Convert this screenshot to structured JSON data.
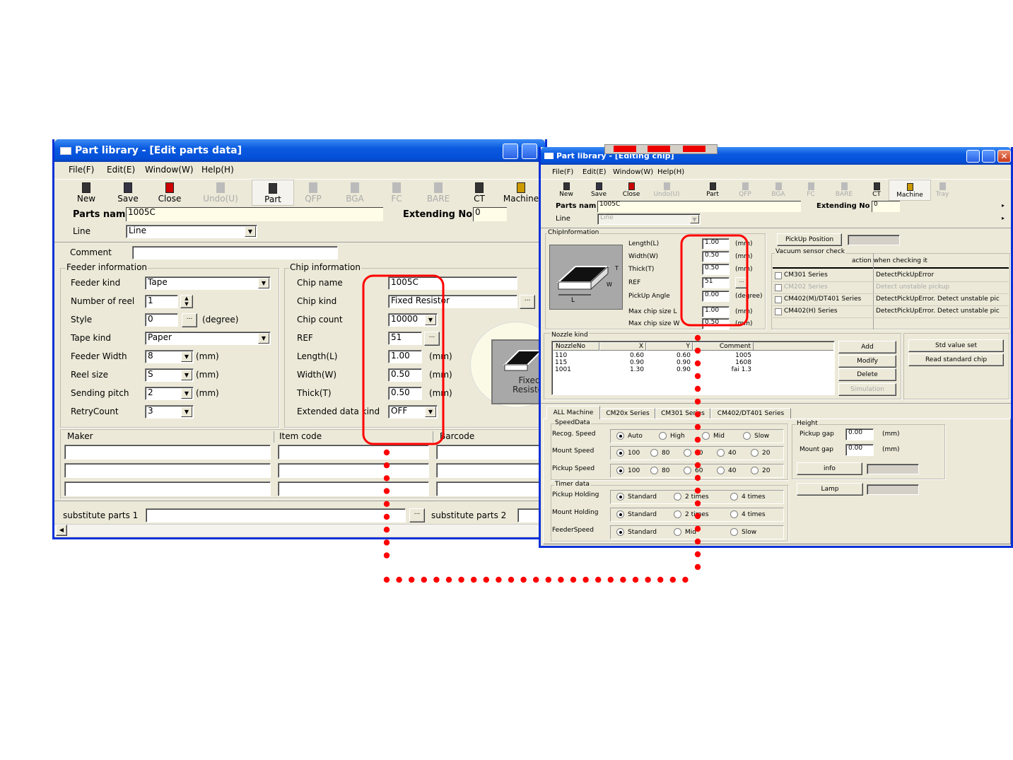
{
  "window1": {
    "title": "Part library - [Edit parts data]",
    "menu": [
      "File(F)",
      "Edit(E)",
      "Window(W)",
      "Help(H)"
    ],
    "toolbar": [
      {
        "label": "New",
        "icon": "new-icon",
        "color": "#333",
        "enabled": true
      },
      {
        "label": "Save",
        "icon": "save-icon",
        "color": "#334",
        "enabled": true
      },
      {
        "label": "Close",
        "icon": "close-door-icon",
        "color": "#c00",
        "enabled": true
      },
      {
        "label": "Undo(U)",
        "icon": "undo-icon",
        "color": "#bbb",
        "enabled": false
      },
      {
        "label": "Part",
        "icon": "part-icon",
        "color": "#333",
        "enabled": true,
        "pressed": true
      },
      {
        "label": "QFP",
        "icon": "qfp-icon",
        "color": "#bbb",
        "enabled": false
      },
      {
        "label": "BGA",
        "icon": "bga-icon",
        "color": "#bbb",
        "enabled": false
      },
      {
        "label": "FC",
        "icon": "fc-icon",
        "color": "#bbb",
        "enabled": false
      },
      {
        "label": "BARE",
        "icon": "bare-icon",
        "color": "#bbb",
        "enabled": false
      },
      {
        "label": "CT",
        "icon": "camera-icon",
        "color": "#333",
        "enabled": true
      },
      {
        "label": "Machine",
        "icon": "machine-icon",
        "color": "#c90",
        "enabled": true
      }
    ],
    "parts_name_label": "Parts nam",
    "parts_name": "1005C",
    "extending_label": "Extending No",
    "extending_no": "0",
    "line_label": "Line",
    "line_value": "Line",
    "comment_label": "Comment",
    "comment_value": "",
    "feeder": {
      "legend": "Feeder information",
      "rows": [
        {
          "label": "Feeder kind",
          "value": "Tape"
        },
        {
          "label": "Number of reel",
          "value": "1"
        },
        {
          "label": "Style",
          "value": "0",
          "unit": "(degree)"
        },
        {
          "label": "Tape kind",
          "value": "Paper"
        },
        {
          "label": "Feeder Width",
          "value": "8",
          "unit": "(mm)"
        },
        {
          "label": "Reel size",
          "value": "S",
          "unit": "(mm)"
        },
        {
          "label": "Sending pitch",
          "value": "2",
          "unit": "(mm)"
        },
        {
          "label": "RetryCount",
          "value": "3"
        }
      ]
    },
    "chip": {
      "legend": "Chip information",
      "rows": [
        {
          "label": "Chip name",
          "value": "1005C"
        },
        {
          "label": "Chip kind",
          "value": "Fixed Resistor"
        },
        {
          "label": "Chip count",
          "value": "10000"
        },
        {
          "label": "REF",
          "value": "51"
        },
        {
          "label": "Length(L)",
          "value": "1.00",
          "unit": "(mm)"
        },
        {
          "label": "Width(W)",
          "value": "0.50",
          "unit": "(mm)"
        },
        {
          "label": "Thick(T)",
          "value": "0.50",
          "unit": "(mm)"
        },
        {
          "label": "Extended data kind",
          "value": "OFF"
        }
      ]
    },
    "image_caption": "Fixed Resistor",
    "maker_headers": [
      "Maker",
      "Item code",
      "Barcode"
    ],
    "substitute1_label": "substitute parts 1",
    "substitute2_label": "substitute parts 2",
    "ellipsis": "..."
  },
  "window2": {
    "title": "Part library - [Editing chip]",
    "menu": [
      "File(F)",
      "Edit(E)",
      "Window(W)",
      "Help(H)"
    ],
    "toolbar": [
      {
        "label": "New",
        "icon": "new-icon",
        "color": "#333",
        "enabled": true
      },
      {
        "label": "Save",
        "icon": "save-icon",
        "color": "#334",
        "enabled": true
      },
      {
        "label": "Close",
        "icon": "close-door-icon",
        "color": "#c00",
        "enabled": true
      },
      {
        "label": "Undo(U)",
        "icon": "undo-icon",
        "color": "#bbb",
        "enabled": false
      },
      {
        "label": "Part",
        "icon": "part-icon",
        "color": "#333",
        "enabled": true
      },
      {
        "label": "QFP",
        "icon": "qfp-icon",
        "color": "#bbb",
        "enabled": false
      },
      {
        "label": "BGA",
        "icon": "bga-icon",
        "color": "#bbb",
        "enabled": false
      },
      {
        "label": "FC",
        "icon": "fc-icon",
        "color": "#bbb",
        "enabled": false
      },
      {
        "label": "BARE",
        "icon": "bare-icon",
        "color": "#bbb",
        "enabled": false
      },
      {
        "label": "CT",
        "icon": "camera-icon",
        "color": "#333",
        "enabled": true
      },
      {
        "label": "Machine",
        "icon": "machine-icon",
        "color": "#c90",
        "enabled": true,
        "pressed": true
      },
      {
        "label": "Tray",
        "icon": "tray-icon",
        "color": "#bbb",
        "enabled": false
      }
    ],
    "parts_name_label": "Parts nam",
    "parts_name": "1005C",
    "extending_label": "Extending No",
    "extending_no": "0",
    "line_label": "Line",
    "line_value": "Line",
    "chipinfo": {
      "legend": "ChipInformation",
      "rows": [
        {
          "label": "Length(L)",
          "value": "1.00",
          "unit": "(mm)"
        },
        {
          "label": "Width(W)",
          "value": "0.50",
          "unit": "(mm)"
        },
        {
          "label": "Thick(T)",
          "value": "0.50",
          "unit": "(mm)"
        },
        {
          "label": "REF",
          "value": "51"
        },
        {
          "label": "PickUp Angle",
          "value": "0.00",
          "unit": "(degree)"
        },
        {
          "label": "Max chip size L",
          "value": "1.00",
          "unit": "(mm)"
        },
        {
          "label": "Max chip size W",
          "value": "0.50",
          "unit": "(mm)"
        }
      ]
    },
    "pickup_position_label": "PickUp Position",
    "vacuum": {
      "legend": "Vacuum sensor check",
      "header": "action when checking it",
      "rows": [
        {
          "series": "CM301 Series",
          "action": "DetectPickUpError",
          "enabled": true
        },
        {
          "series": "CM202 Series",
          "action": "Detect unstable pickup",
          "enabled": false
        },
        {
          "series": "CM402(M)/DT401 Series",
          "action": "DetectPickUpError. Detect unstable pic",
          "enabled": true
        },
        {
          "series": "CM402(H) Series",
          "action": "DetectPickUpError. Detect unstable pic",
          "enabled": true
        }
      ]
    },
    "nozzle": {
      "legend": "Nozzle kind",
      "headers": [
        "NozzleNo",
        "X",
        "Y",
        "Comment"
      ],
      "rows": [
        [
          "110",
          "0.60",
          "0.60",
          "1005"
        ],
        [
          "115",
          "0.90",
          "0.90",
          "1608"
        ],
        [
          "1001",
          "1.30",
          "0.90",
          "fai 1.3"
        ]
      ],
      "buttons": [
        "Add",
        "Modify",
        "Delete",
        "Simulation"
      ]
    },
    "std_value_set": "Std value set",
    "read_standard_chip": "Read standard chip",
    "tabs": [
      "ALL Machine",
      "CM20x Series",
      "CM301 Series",
      "CM402/DT401 Series"
    ],
    "speed": {
      "legend": "SpeedData",
      "rows": [
        {
          "label": "Recog. Speed",
          "options": [
            "Auto",
            "High",
            "Mid",
            "Slow"
          ],
          "selected": 0
        },
        {
          "label": "Mount Speed",
          "options": [
            "100",
            "80",
            "60",
            "40",
            "20"
          ],
          "selected": 0
        },
        {
          "label": "Pickup Speed",
          "options": [
            "100",
            "80",
            "60",
            "40",
            "20"
          ],
          "selected": 0
        }
      ]
    },
    "timer": {
      "legend": "Timer data",
      "rows": [
        {
          "label": "Pickup Holding",
          "options": [
            "Standard",
            "2 times",
            "4 times"
          ],
          "selected": 0
        },
        {
          "label": "Mount Holding",
          "options": [
            "Standard",
            "2 times",
            "4 times"
          ],
          "selected": 0
        },
        {
          "label": "FeederSpeed",
          "options": [
            "Standard",
            "Mid",
            "Slow"
          ],
          "selected": 0
        }
      ]
    },
    "height": {
      "legend": "Height",
      "pickup_gap_label": "Pickup gap",
      "pickup_gap": "0.00",
      "mount_gap_label": "Mount gap",
      "mount_gap": "0.00",
      "unit": "(mm)"
    },
    "info_label": "info",
    "lamp_label": "Lamp",
    "ellipsis": "..."
  },
  "annotation": {
    "color": "#ff0000"
  }
}
